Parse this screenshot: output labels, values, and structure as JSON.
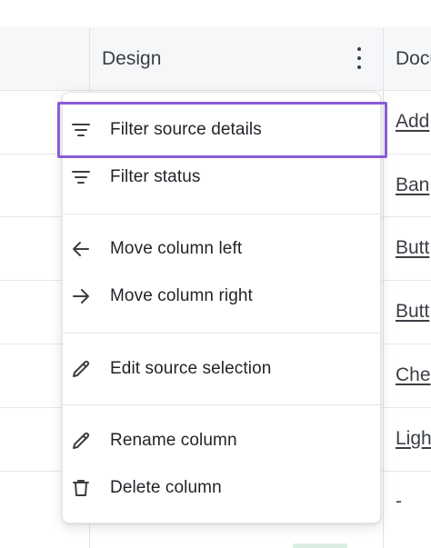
{
  "table": {
    "header": {
      "design_label": "Design",
      "next_column_label": "Document"
    },
    "next_column_values": [
      "Add",
      "Ban",
      "Butt",
      "Butt",
      "Che",
      "Ligh",
      "-"
    ]
  },
  "menu": {
    "items": [
      {
        "label": "Filter source details",
        "icon": "filter-icon"
      },
      {
        "label": "Filter status",
        "icon": "filter-icon"
      },
      {
        "label": "Move column left",
        "icon": "arrow-left-icon"
      },
      {
        "label": "Move column right",
        "icon": "arrow-right-icon"
      },
      {
        "label": "Edit source selection",
        "icon": "pencil-icon"
      },
      {
        "label": "Rename column",
        "icon": "pencil-icon"
      },
      {
        "label": "Delete column",
        "icon": "trash-icon"
      }
    ]
  },
  "colors": {
    "focus_ring": "#8a5cd8",
    "header_background": "#f6f7f9",
    "text": "#1f2328"
  }
}
